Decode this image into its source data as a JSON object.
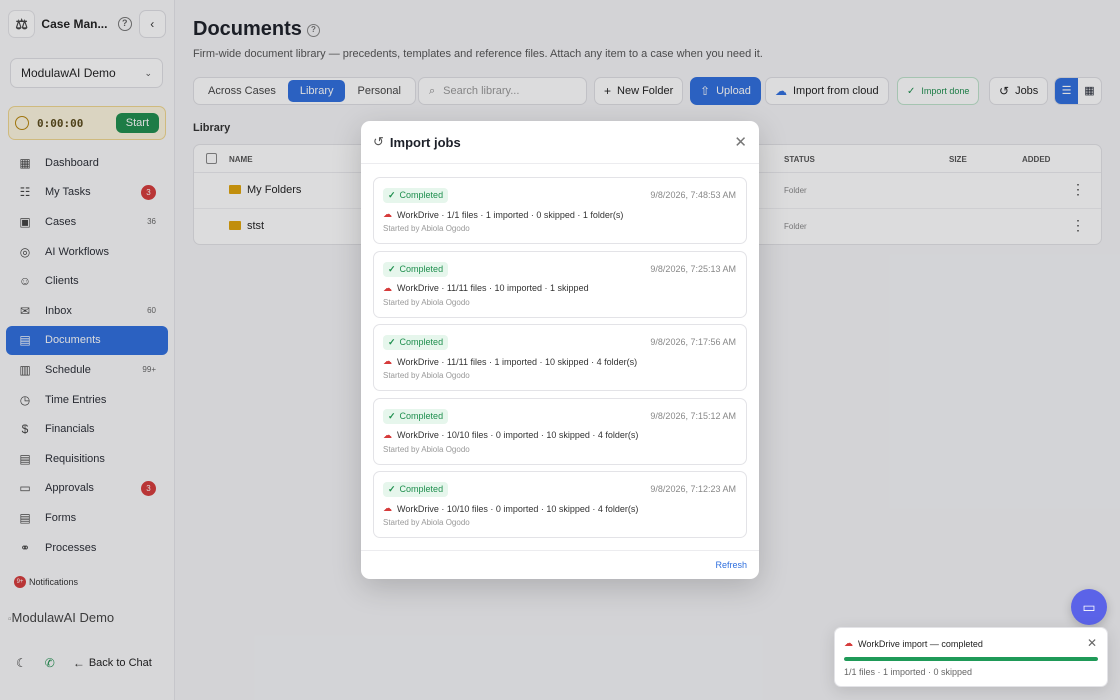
{
  "sidebar": {
    "brand_name": "Case Man...",
    "org": "ModulawAI Demo",
    "timer": {
      "time": "0:00:00",
      "start_label": "Start"
    },
    "items": [
      {
        "label": "Dashboard",
        "icon": "grid-icon",
        "badge": ""
      },
      {
        "label": "My Tasks",
        "icon": "checklist-icon",
        "badge": "3"
      },
      {
        "label": "Cases",
        "icon": "briefcase-icon",
        "badge": "36"
      },
      {
        "label": "AI Workflows",
        "icon": "bot-icon",
        "badge": ""
      },
      {
        "label": "Clients",
        "icon": "users-icon",
        "badge": ""
      },
      {
        "label": "Inbox",
        "icon": "mail-icon",
        "badge": "60"
      },
      {
        "label": "Documents",
        "icon": "document-icon",
        "badge": ""
      },
      {
        "label": "Schedule",
        "icon": "calendar-icon",
        "badge": "99+"
      },
      {
        "label": "Time Entries",
        "icon": "clock-icon",
        "badge": ""
      },
      {
        "label": "Financials",
        "icon": "dollar-icon",
        "badge": ""
      },
      {
        "label": "Requisitions",
        "icon": "clipboard-icon",
        "badge": ""
      },
      {
        "label": "Approvals",
        "icon": "inbox-check-icon",
        "badge": "3"
      },
      {
        "label": "Forms",
        "icon": "form-icon",
        "badge": ""
      },
      {
        "label": "Processes",
        "icon": "flow-icon",
        "badge": ""
      }
    ],
    "notifications_label": "Notifications",
    "notifications_badge": "9+",
    "footer_img_alt": "ModulawAI Demo",
    "back_label": "Back to Chat"
  },
  "page": {
    "title": "Documents",
    "subtitle": "Firm-wide document library — precedents, templates and reference files. Attach any item to a case when you need it.",
    "tabs": [
      "Across Cases",
      "Library",
      "Personal"
    ],
    "active_tab": "Library",
    "search_placeholder": "Search library...",
    "buttons": {
      "new_folder": "New Folder",
      "upload": "Upload",
      "import_cloud": "Import from cloud",
      "import_done": "Import done",
      "jobs": "Jobs"
    },
    "section_label": "Library",
    "columns": {
      "name": "NAME",
      "status": "STATUS",
      "size": "SIZE",
      "added": "ADDED"
    },
    "rows": [
      {
        "name": "My Folders",
        "status": "Folder"
      },
      {
        "name": "stst",
        "status": "Folder"
      }
    ]
  },
  "modal": {
    "title": "Import jobs",
    "refresh_label": "Refresh",
    "jobs": [
      {
        "status": "Completed",
        "timestamp": "9/8/2026, 7:48:53 AM",
        "summary": "WorkDrive · 1/1 files · 1 imported · 0 skipped · 1 folder(s)",
        "started_by": "Started by Abiola Ogodo"
      },
      {
        "status": "Completed",
        "timestamp": "9/8/2026, 7:25:13 AM",
        "summary": "WorkDrive · 11/11 files · 10 imported · 1 skipped",
        "started_by": "Started by Abiola Ogodo"
      },
      {
        "status": "Completed",
        "timestamp": "9/8/2026, 7:17:56 AM",
        "summary": "WorkDrive · 11/11 files · 1 imported · 10 skipped · 4 folder(s)",
        "started_by": "Started by Abiola Ogodo"
      },
      {
        "status": "Completed",
        "timestamp": "9/8/2026, 7:15:12 AM",
        "summary": "WorkDrive · 10/10 files · 0 imported · 10 skipped · 4 folder(s)",
        "started_by": "Started by Abiola Ogodo"
      },
      {
        "status": "Completed",
        "timestamp": "9/8/2026, 7:12:23 AM",
        "summary": "WorkDrive · 10/10 files · 0 imported · 10 skipped · 4 folder(s)",
        "started_by": "Started by Abiola Ogodo"
      }
    ]
  },
  "toast": {
    "title": "WorkDrive import — completed",
    "stats": "1/1 files · 1 imported · 0 skipped",
    "progress_percent": 100
  },
  "colors": {
    "accent": "#2f6fde",
    "success": "#1f8f4e",
    "danger": "#d63b3b",
    "chat_fab": "#5b63e8"
  }
}
